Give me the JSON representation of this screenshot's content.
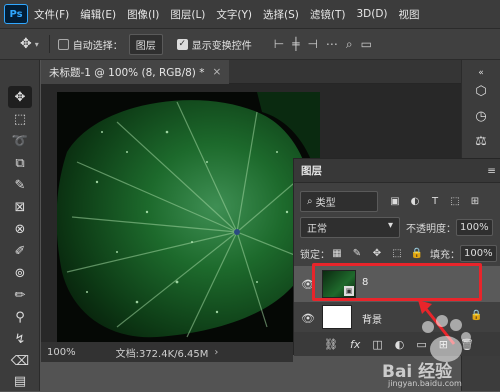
{
  "app": {
    "logo": "Ps"
  },
  "menu": {
    "items": [
      "文件(F)",
      "编辑(E)",
      "图像(I)",
      "图层(L)",
      "文字(Y)",
      "选择(S)",
      "滤镜(T)",
      "3D(D)",
      "视图"
    ]
  },
  "options": {
    "auto_select_label": "自动选择：",
    "auto_select_target": "图层",
    "show_transform_label": "显示变换控件"
  },
  "document": {
    "tab_title": "未标题-1 @ 100% (8, RGB/8) *",
    "close_label": "×"
  },
  "status": {
    "zoom": "100%",
    "doc_info": "文档:372.4K/6.45M"
  },
  "layers_panel": {
    "title": "图层",
    "menu_icon": "≡",
    "filter_kind": "类型",
    "blend_mode": "正常",
    "opacity_label": "不透明度：",
    "opacity_value": "100%",
    "lock_label": "锁定：",
    "fill_label": "填充：",
    "fill_value": "100%",
    "layers": [
      {
        "name": "8",
        "visible": true,
        "selected": true
      },
      {
        "name": "背景",
        "visible": true,
        "locked": true
      }
    ]
  },
  "watermark": {
    "text": "Bai 经验",
    "url": "jingyan.baidu.com"
  },
  "colors": {
    "annotation_red": "#e8252b",
    "accent": "#31a8ff"
  }
}
